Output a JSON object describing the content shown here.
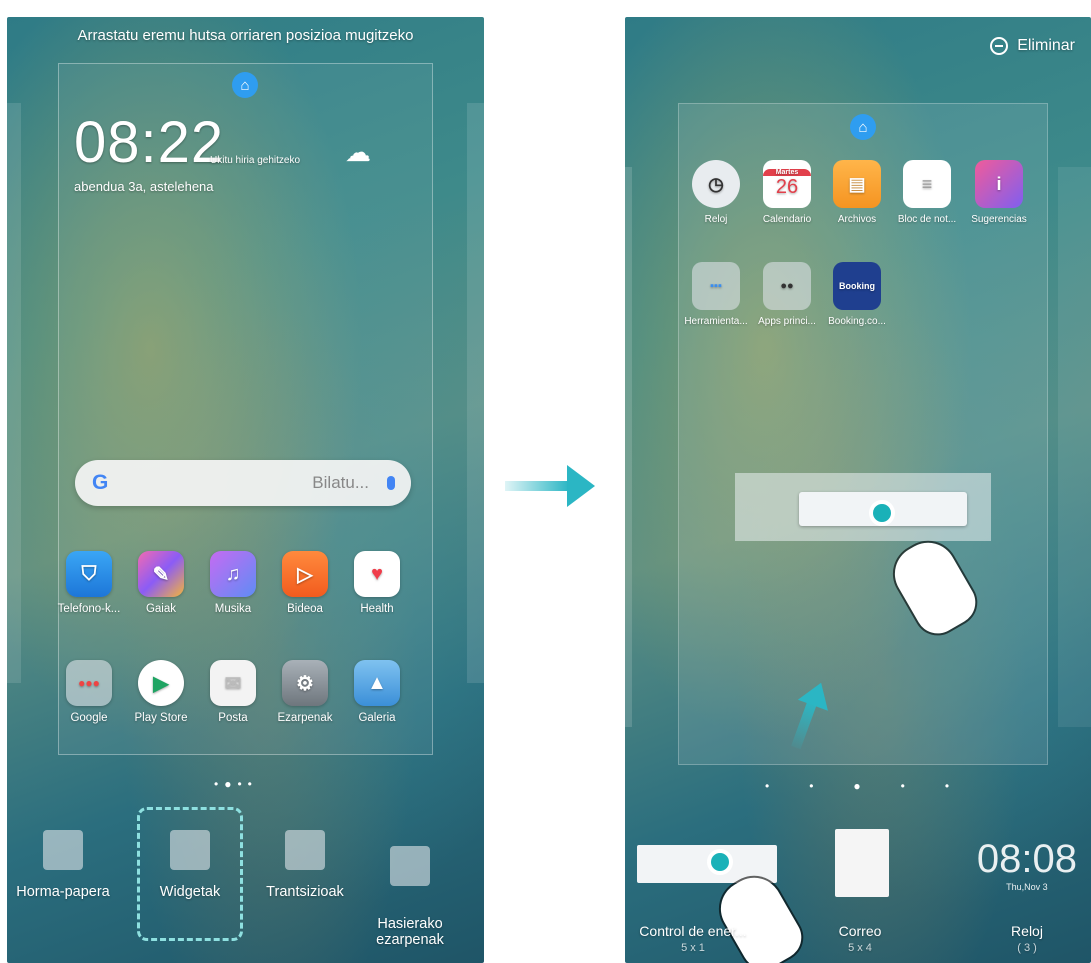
{
  "left": {
    "hint": "Arrastatu eremu hutsa orriaren posizioa mugitzeko",
    "clock": "08:22",
    "clock_tip": "Ukitu hiria gehitzeko",
    "date": "abendua 3a, astelehena",
    "search_placeholder": "Bilatu...",
    "apps_row1": [
      "Telefono-k...",
      "Gaiak",
      "Musika",
      "Bideoa",
      "Health"
    ],
    "apps_row2": [
      "Google",
      "Play Store",
      "Posta",
      "Ezarpenak",
      "Galeria"
    ],
    "bottom": [
      "Horma-papera",
      "Widgetak",
      "Trantsizioak",
      "Hasierako\nezarpenak"
    ]
  },
  "right": {
    "delete_label": "Eliminar",
    "calendar_header": "Martes",
    "calendar_day": "26",
    "apps_row1": [
      "Reloj",
      "Calendario",
      "Archivos",
      "Bloc de not...",
      "Sugerencias"
    ],
    "apps_row2": [
      "Herramienta...",
      "Apps princi...",
      "Booking.co..."
    ],
    "booking_text": "Booking",
    "widgets": [
      {
        "name": "Control de ener...",
        "size": "5 x 1"
      },
      {
        "name": "Correo",
        "size": "5 x 4"
      },
      {
        "name": "Reloj",
        "size": "( 3 )"
      }
    ],
    "clock": "08:08",
    "clock_date": "Thu,Nov 3"
  },
  "colors": {
    "accent": "#2bb6c4",
    "home_blue": "#2f9df0",
    "dash": "#8ee0e0"
  }
}
